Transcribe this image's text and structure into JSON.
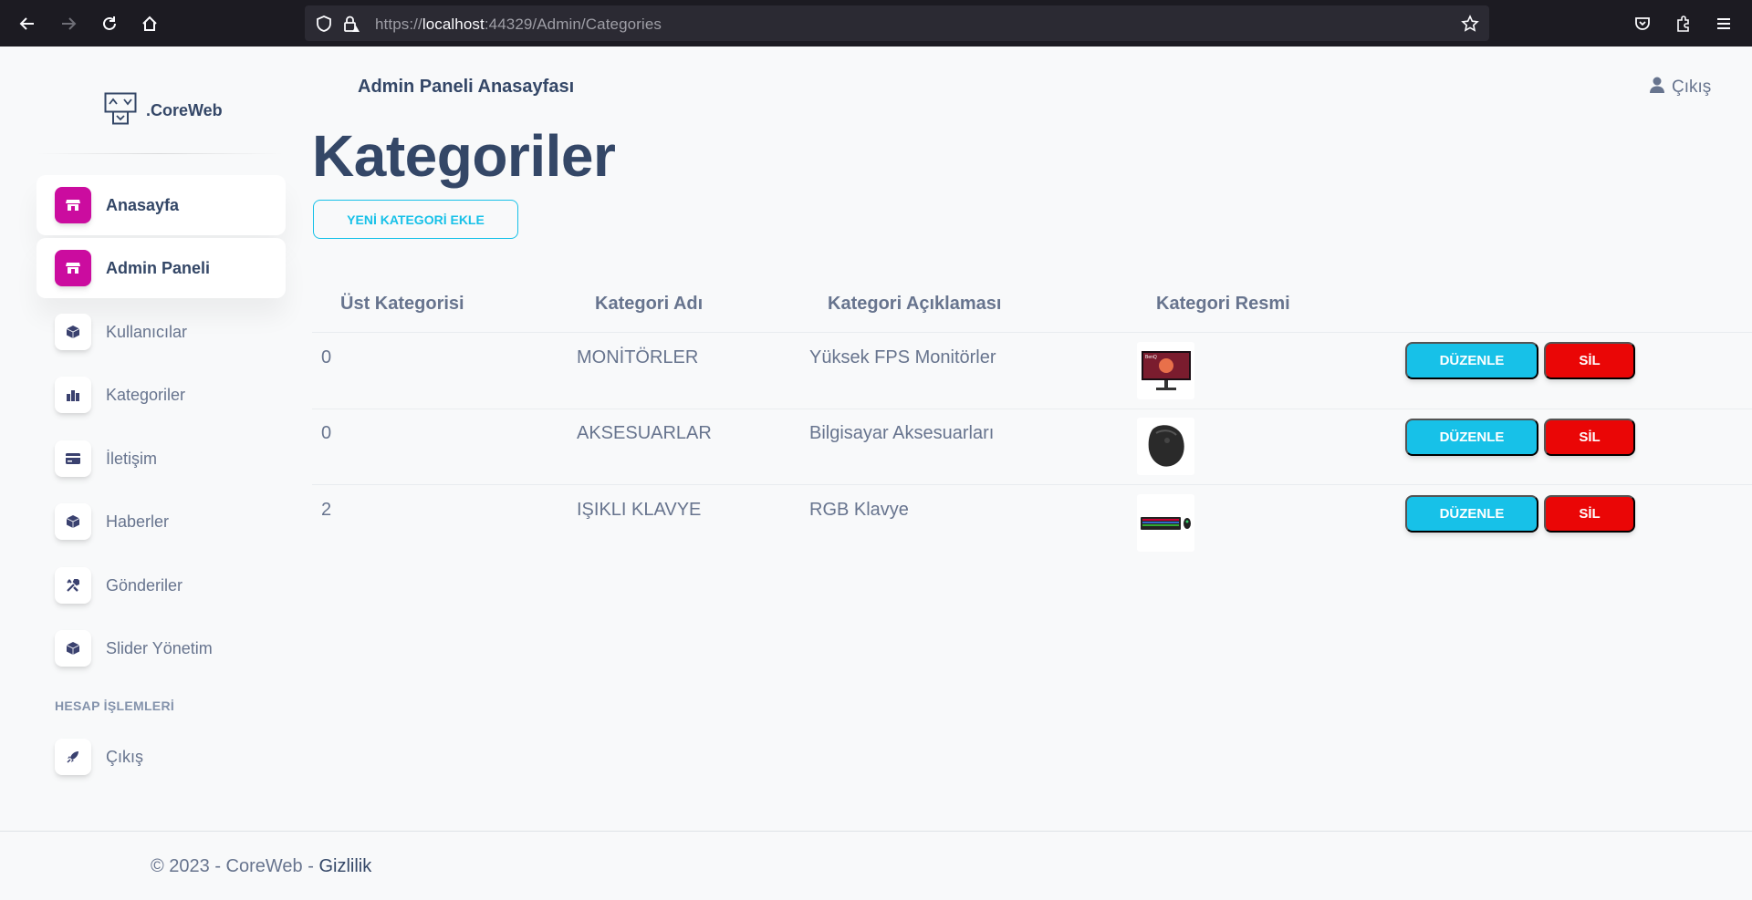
{
  "browser": {
    "url_prefix": "https://",
    "url_host": "localhost",
    "url_rest": ":44329/Admin/Categories"
  },
  "sidebar": {
    "brand": ".CoreWeb",
    "items": [
      {
        "label": "Anasayfa",
        "icon": "shop-icon",
        "active": true
      },
      {
        "label": "Admin Paneli",
        "icon": "shop-icon",
        "active": true
      },
      {
        "label": "Kullanıcılar",
        "icon": "box-icon"
      },
      {
        "label": "Kategoriler",
        "icon": "chart-icon"
      },
      {
        "label": "İletişim",
        "icon": "credit-card-icon"
      },
      {
        "label": "Haberler",
        "icon": "box-icon"
      },
      {
        "label": "Gönderiler",
        "icon": "tools-icon"
      },
      {
        "label": "Slider Yönetim",
        "icon": "box-icon"
      }
    ],
    "section_title": "HESAP İŞLEMLERİ",
    "logout_item": {
      "label": "Çıkış",
      "icon": "rocket-icon"
    }
  },
  "header": {
    "title": "Admin Paneli Anasayfası",
    "logout": "Çıkış"
  },
  "main": {
    "title": "Kategoriler",
    "add_button": "YENİ KATEGORİ EKLE",
    "columns": [
      "Üst Kategorisi",
      "Kategori Adı",
      "Kategori Açıklaması",
      "Kategori Resmi"
    ],
    "rows": [
      {
        "parent": "0",
        "name": "MONİTÖRLER",
        "description": "Yüksek FPS Monitörler",
        "image": "monitor-image",
        "edit": "DÜZENLE",
        "delete": "SİL"
      },
      {
        "parent": "0",
        "name": "AKSESUARLAR",
        "description": "Bilgisayar Aksesuarları",
        "image": "mouse-image",
        "edit": "DÜZENLE",
        "delete": "SİL"
      },
      {
        "parent": "2",
        "name": "IŞIKLI KLAVYE",
        "description": "RGB Klavye",
        "image": "keyboard-image",
        "edit": "DÜZENLE",
        "delete": "SİL"
      }
    ]
  },
  "footer": {
    "copyright": "© 2023 - CoreWeb - ",
    "privacy": "Gizlilik"
  },
  "colors": {
    "primary_pink": "#cb0c9f",
    "info": "#17c1e8",
    "danger": "#ea0606",
    "text_dark": "#344767",
    "text_muted": "#67748e"
  }
}
